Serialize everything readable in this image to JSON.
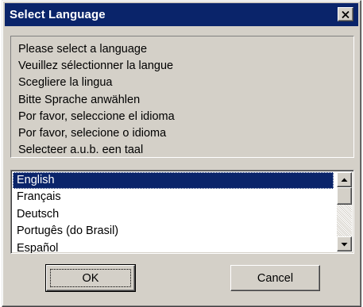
{
  "window": {
    "title": "Select Language"
  },
  "icons": {
    "close": "close-icon",
    "scroll_up": "arrow-up-icon",
    "scroll_down": "arrow-down-icon"
  },
  "prompt": {
    "lines": [
      "Please select a language",
      "Veuillez sélectionner la langue",
      "Scegliere la lingua",
      "Bitte Sprache anwählen",
      "Por favor, seleccione el idioma",
      "Por favor, selecione o idioma",
      "Selecteer a.u.b. een taal"
    ]
  },
  "language_list": {
    "selected": "English",
    "items": [
      "English",
      "Français",
      "Deutsch",
      "Portugês (do Brasil)",
      "Español"
    ]
  },
  "buttons": {
    "ok_label": "OK",
    "cancel_label": "Cancel"
  },
  "colors": {
    "titlebar": "#0a246a",
    "dialog_face": "#d4d0c8",
    "selection": "#0a246a"
  }
}
